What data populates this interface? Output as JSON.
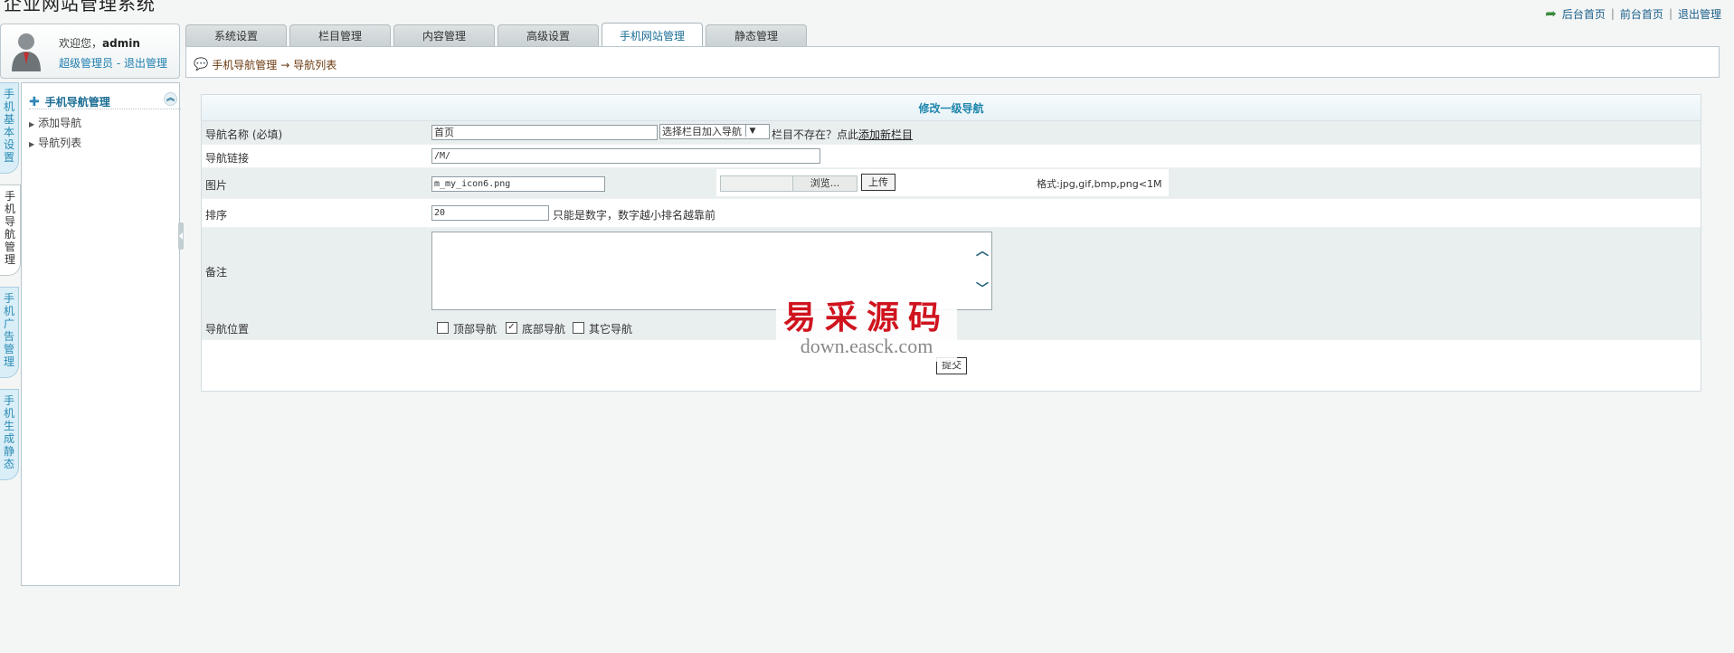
{
  "header": {
    "system_title": "企业网站管理系统",
    "top_links": [
      "后台首页",
      "前台首页",
      "退出管理"
    ]
  },
  "user": {
    "welcome_prefix": "欢迎您，",
    "username": "admin",
    "role": "超级管理员",
    "separator": " - ",
    "logout": "退出管理"
  },
  "tabs": [
    {
      "label": "系统设置",
      "active": false
    },
    {
      "label": "栏目管理",
      "active": false
    },
    {
      "label": "内容管理",
      "active": false
    },
    {
      "label": "高级设置",
      "active": false
    },
    {
      "label": "手机网站管理",
      "active": true
    },
    {
      "label": "静态管理",
      "active": false
    }
  ],
  "breadcrumb": {
    "parent": "手机导航管理",
    "arrow": "→",
    "current": "导航列表"
  },
  "side_tabs": [
    {
      "label": "手机基本设置",
      "active": false
    },
    {
      "label": "手机导航管理",
      "active": true
    },
    {
      "label": "手机广告管理",
      "active": false
    },
    {
      "label": "手机生成静态",
      "active": false
    }
  ],
  "side_panel": {
    "title": "手机导航管理",
    "items": [
      "添加导航",
      "导航列表"
    ]
  },
  "form": {
    "title": "修改一级导航",
    "name_label": "导航名称 (必填)",
    "name_value": "首页",
    "select_value": "选择栏目加入导航",
    "column_missing": "栏目不存在？点此",
    "add_column_link": "添加新栏目",
    "link_label": "导航链接",
    "link_value": "/M/",
    "image_label": "图片",
    "image_value": "m_my_icon6.png",
    "browse_label": "浏览...",
    "upload_label": "上传",
    "format_note": "格式:jpg,gif,bmp,png<1M",
    "sort_label": "排序",
    "sort_value": "20",
    "sort_note": "只能是数字，数字越小排名越靠前",
    "remark_label": "备注",
    "position_label": "导航位置",
    "positions": [
      {
        "label": "顶部导航",
        "checked": false
      },
      {
        "label": "底部导航",
        "checked": true
      },
      {
        "label": "其它导航",
        "checked": false
      }
    ],
    "submit_label": "提交"
  },
  "watermark": {
    "cn": "易采源码",
    "en": "down.easck.com"
  }
}
